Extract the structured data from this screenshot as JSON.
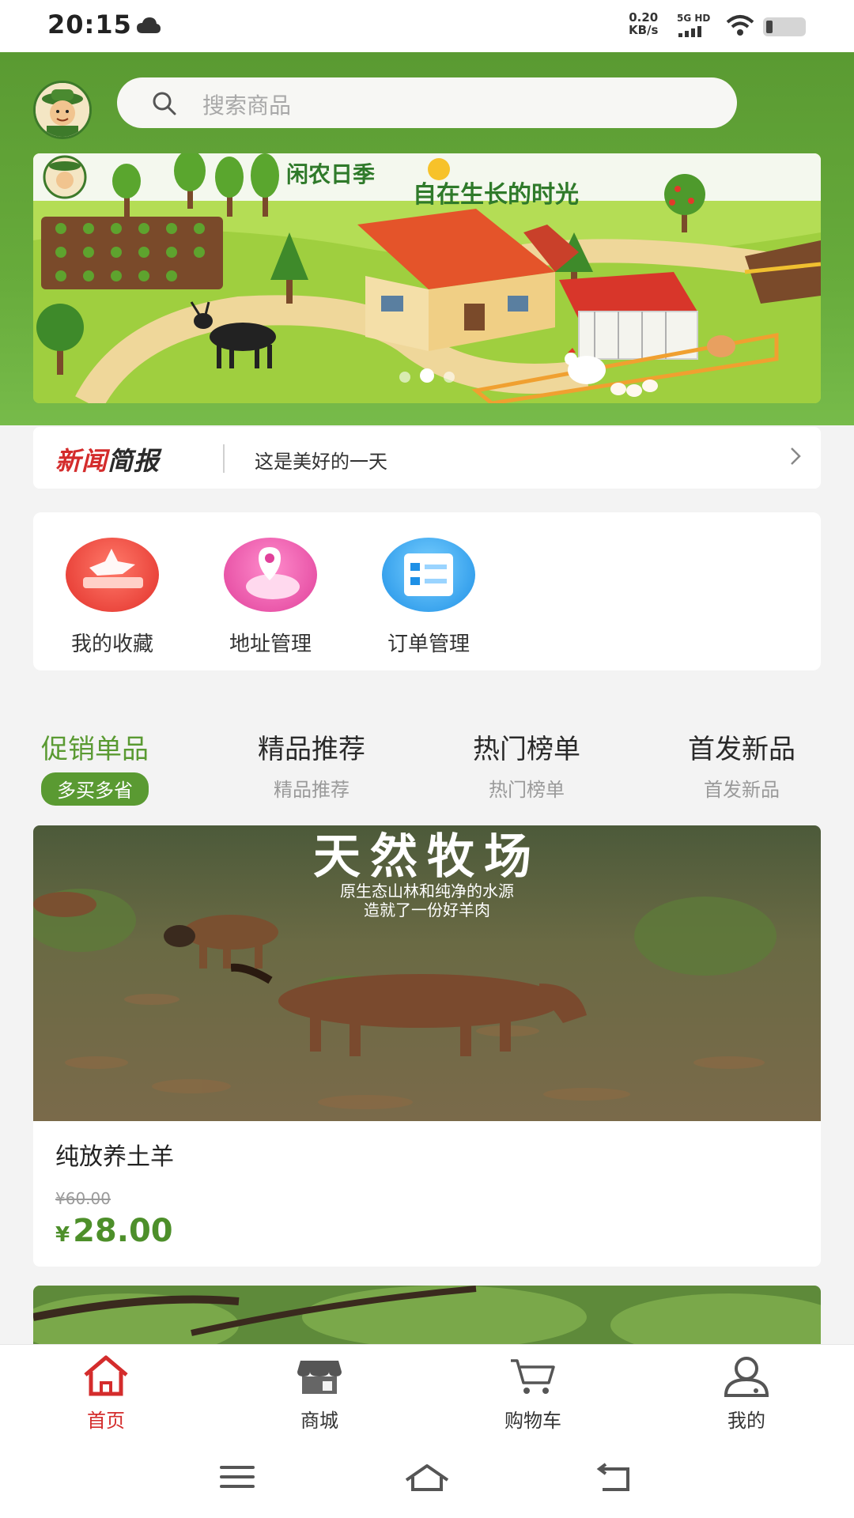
{
  "status_bar": {
    "time": "20:15",
    "net_speed_value": "0.20",
    "net_speed_unit": "KB/s",
    "network": "5G HD"
  },
  "header": {
    "search_placeholder": "搜索商品",
    "banner_title": "闲农日季",
    "banner_subtitle": "自在生长的时光"
  },
  "news": {
    "brand_part1": "新闻",
    "brand_part2": "简报",
    "text": "这是美好的一天"
  },
  "quick_menu": [
    {
      "label": "我的收藏",
      "icon": "favorites-icon"
    },
    {
      "label": "地址管理",
      "icon": "location-icon"
    },
    {
      "label": "订单管理",
      "icon": "order-icon"
    }
  ],
  "tabs": [
    {
      "title": "促销单品",
      "sub": "多买多省"
    },
    {
      "title": "精品推荐",
      "sub": "精品推荐"
    },
    {
      "title": "热门榜单",
      "sub": "热门榜单"
    },
    {
      "title": "首发新品",
      "sub": "首发新品"
    }
  ],
  "products": [
    {
      "image_title": "天然牧场",
      "image_sub1": "原生态山林和纯净的水源",
      "image_sub2": "造就了一份好羊肉",
      "title": "纯放养土羊",
      "old_price": "¥60.00",
      "currency": "¥",
      "price": "28.00"
    }
  ],
  "bottom_nav": [
    {
      "label": "首页",
      "icon": "home-icon"
    },
    {
      "label": "商城",
      "icon": "store-icon"
    },
    {
      "label": "购物车",
      "icon": "cart-icon"
    },
    {
      "label": "我的",
      "icon": "profile-icon"
    }
  ],
  "colors": {
    "brand_green": "#5a9a32",
    "accent_red": "#d42c2c"
  }
}
